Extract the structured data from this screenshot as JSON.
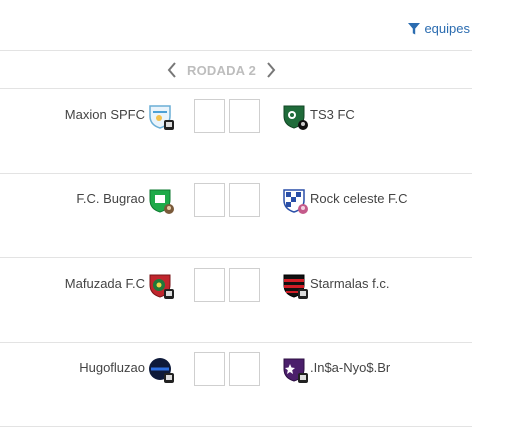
{
  "toolbar": {
    "filter_label": "equipes",
    "filter_icon": "filter-icon"
  },
  "round": {
    "label": "RODADA 2",
    "prev_icon": "chevron-left-icon",
    "next_icon": "chevron-right-icon"
  },
  "matches": [
    {
      "home": "Maxion SPFC",
      "away": "TS3 FC",
      "home_score": "",
      "away_score": ""
    },
    {
      "home": "F.C. Bugrao",
      "away": "Rock celeste F.C",
      "home_score": "",
      "away_score": ""
    },
    {
      "home": "Mafuzada F.C",
      "away": "Starmalas f.c.",
      "home_score": "",
      "away_score": ""
    },
    {
      "home": "Hugofluzao",
      "away": ".In$a-Nyo$.Br",
      "home_score": "",
      "away_score": ""
    }
  ],
  "colors": {
    "accent": "#2b6cb0",
    "divider": "#e3e3e3",
    "round_label": "#bdbdbd"
  }
}
